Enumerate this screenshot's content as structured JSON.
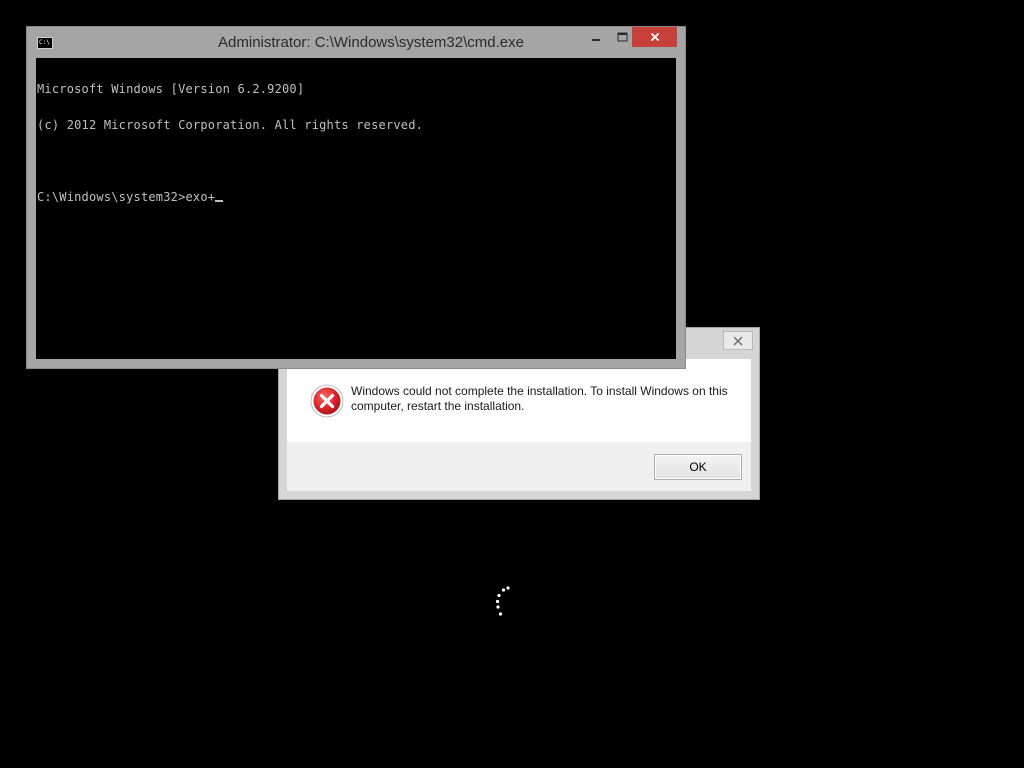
{
  "console": {
    "title": "Administrator: C:\\Windows\\system32\\cmd.exe",
    "app_icon": "cmd-icon",
    "app_icon_text": "C:\\",
    "lines": [
      "Microsoft Windows [Version 6.2.9200]",
      "(c) 2012 Microsoft Corporation. All rights reserved."
    ],
    "prompt": "C:\\Windows\\system32>",
    "input": "exo+",
    "text_color": "#c0c0c0",
    "close_color": "#c7403a"
  },
  "dialog": {
    "icon": "error-icon",
    "message": "Windows could not complete the installation. To install Windows on this computer, restart the installation.",
    "ok_label": "OK",
    "close_icon": "close-icon",
    "error_color": "#d9262d"
  },
  "spinner": {
    "icon": "loading-spinner-icon"
  }
}
